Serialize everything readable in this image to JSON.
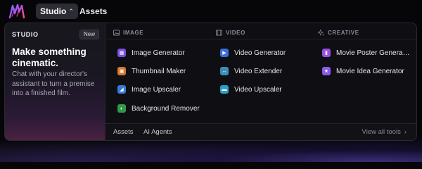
{
  "nav": {
    "studio_label": "Studio",
    "assets_label": "Assets"
  },
  "studio_card": {
    "eyebrow": "STUDIO",
    "badge": "New",
    "headline": "Make something cinematic.",
    "description": "Chat with your director's assistant to turn a premise into a finished film."
  },
  "columns": [
    {
      "heading": "IMAGE",
      "icon": "image-icon",
      "items": [
        {
          "label": "Image Generator",
          "icon": "image-generator-icon",
          "color": "#7b4fe0"
        },
        {
          "label": "Thumbnail Maker",
          "icon": "thumbnail-icon",
          "color": "#d9772b"
        },
        {
          "label": "Image Upscaler",
          "icon": "upscale-icon",
          "color": "#3a7bd5"
        },
        {
          "label": "Background Remover",
          "icon": "background-remover-icon",
          "color": "#2f9a4a"
        }
      ]
    },
    {
      "heading": "VIDEO",
      "icon": "film-icon",
      "items": [
        {
          "label": "Video Generator",
          "icon": "play-icon",
          "color": "#3a6fd8"
        },
        {
          "label": "Video Extender",
          "icon": "extend-icon",
          "color": "#3a8fb8"
        },
        {
          "label": "Video Upscaler",
          "icon": "video-upscale-icon",
          "color": "#2aa0c8"
        }
      ]
    },
    {
      "heading": "CREATIVE",
      "icon": "sparkle-icon",
      "items": [
        {
          "label": "Movie Poster Generator",
          "icon": "poster-icon",
          "color": "#9b4fe0"
        },
        {
          "label": "Movie Idea Generator",
          "icon": "idea-icon",
          "color": "#8a5ae8"
        }
      ]
    }
  ],
  "footer": {
    "assets_link": "Assets",
    "agents_link": "AI Agents",
    "view_all": "View all tools"
  }
}
